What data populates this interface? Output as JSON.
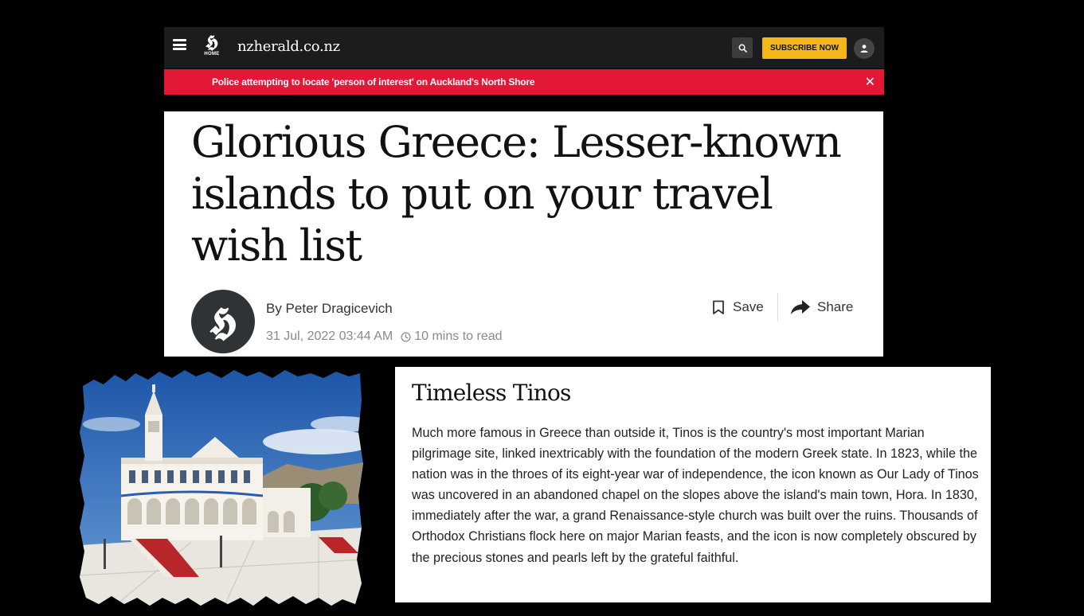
{
  "nav": {
    "logo_glyph": "𝕳",
    "home_label": "HOME",
    "site_name": "nzherald.co.nz",
    "subscribe_label": "SUBSCRIBE NOW"
  },
  "banner": {
    "text": "Police attempting to locate 'person of interest' on Auckland's North Shore",
    "close": "✕"
  },
  "article": {
    "headline": "Glorious Greece: Lesser-known islands to put on your travel wish list",
    "avatar_glyph": "𝕳",
    "byline": "By Peter Dragicevich",
    "date": "31 Jul, 2022 03:44 AM",
    "read_time": "10 mins to read",
    "save_label": "Save",
    "share_label": "Share"
  },
  "section": {
    "title": "Timeless Tinos",
    "body": "Much more famous in Greece than outside it, Tinos is the country's most important Marian pilgrimage site, linked inextricably with the foundation of the modern Greek state. In 1823, while the nation was in the throes of its eight-year war of independence, the icon known as Our Lady of Tinos was uncovered in an abandoned chapel on the slopes above the island's main town, Hora. In 1830, immediately after the war, a grand Renaissance-style church was built over the ruins. Thousands of Orthodox Christians flock here on major Marian feasts, and the icon is now completely obscured by the precious stones and pearls left by the grateful faithful."
  },
  "colors": {
    "nav_bg": "#1b1c1d",
    "banner_bg": "#e31837",
    "subscribe_bg": "#f5b617",
    "avatar_bg": "#2f3336"
  },
  "icons": [
    "menu-icon",
    "search-icon",
    "user-icon",
    "close-icon",
    "bookmark-icon",
    "share-arrow-icon",
    "clock-icon"
  ]
}
